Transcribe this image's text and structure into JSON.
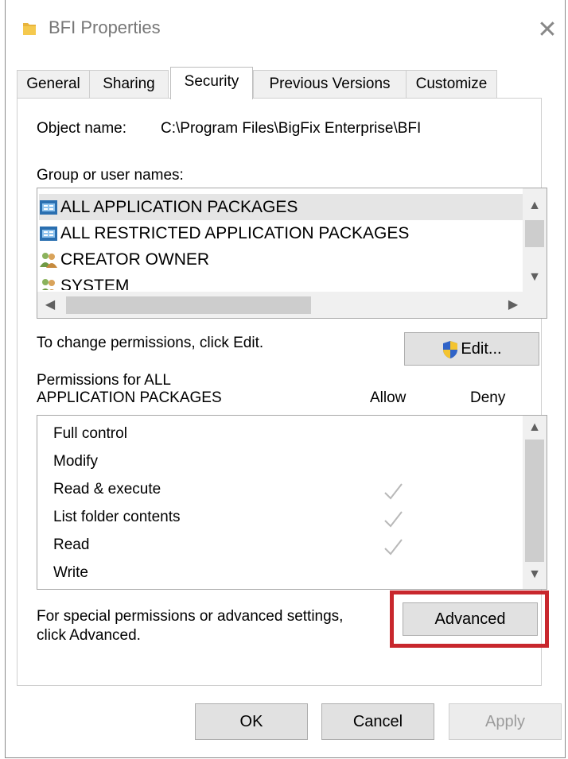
{
  "window": {
    "title": "BFI Properties",
    "close_glyph": "✕"
  },
  "tabs": [
    {
      "label": "General"
    },
    {
      "label": "Sharing"
    },
    {
      "label": "Security"
    },
    {
      "label": "Previous Versions"
    },
    {
      "label": "Customize"
    }
  ],
  "security": {
    "object_name_label": "Object name:",
    "object_name_value": "C:\\Program Files\\BigFix Enterprise\\BFI",
    "group_label": "Group or user names:",
    "groups": [
      {
        "name": "ALL APPLICATION PACKAGES",
        "icon": "package-icon",
        "selected": true
      },
      {
        "name": "ALL RESTRICTED APPLICATION PACKAGES",
        "icon": "package-icon",
        "selected": false
      },
      {
        "name": "CREATOR OWNER",
        "icon": "users-icon",
        "selected": false
      },
      {
        "name": "SYSTEM",
        "icon": "users-icon",
        "selected": false
      }
    ],
    "change_hint": "To change permissions, click Edit.",
    "edit_button": "Edit...",
    "permissions_label_line1": "Permissions for ALL",
    "permissions_label_line2": "APPLICATION PACKAGES",
    "allow_header": "Allow",
    "deny_header": "Deny",
    "permissions": [
      {
        "name": "Full control",
        "allow": false,
        "deny": false
      },
      {
        "name": "Modify",
        "allow": false,
        "deny": false
      },
      {
        "name": "Read & execute",
        "allow": true,
        "deny": false
      },
      {
        "name": "List folder contents",
        "allow": true,
        "deny": false
      },
      {
        "name": "Read",
        "allow": true,
        "deny": false
      },
      {
        "name": "Write",
        "allow": false,
        "deny": false
      }
    ],
    "advanced_hint_line1": "For special permissions or advanced settings,",
    "advanced_hint_line2": "click Advanced.",
    "advanced_button": "Advanced"
  },
  "footer": {
    "ok": "OK",
    "cancel": "Cancel",
    "apply": "Apply"
  },
  "colors": {
    "highlight": "#c8272d",
    "selection": "#e5e5e5",
    "check": "#b8b8b8"
  }
}
